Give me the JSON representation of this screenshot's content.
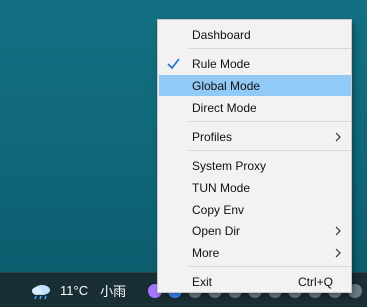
{
  "menu": {
    "items": [
      {
        "label": "Dashboard"
      },
      {
        "label": "Rule Mode",
        "checked": true
      },
      {
        "label": "Global Mode",
        "highlighted": true
      },
      {
        "label": "Direct Mode"
      },
      {
        "label": "Profiles",
        "submenu": true
      },
      {
        "label": "System Proxy"
      },
      {
        "label": "TUN Mode"
      },
      {
        "label": "Copy Env"
      },
      {
        "label": "Open Dir",
        "submenu": true
      },
      {
        "label": "More",
        "submenu": true
      },
      {
        "label": "Exit",
        "shortcut": "Ctrl+Q"
      }
    ],
    "highlight_color": "#91c9f7",
    "check_color": "#1e6fc8"
  },
  "taskbar": {
    "weather": {
      "icon": "cloud-rain-icon",
      "temperature": "11°C",
      "condition": "小雨"
    },
    "tray_icons": [
      "app-tray-icon-purple",
      "app-tray-icon-blue",
      "tray-icon",
      "tray-icon",
      "tray-icon",
      "tray-icon",
      "tray-icon",
      "tray-icon",
      "tray-icon",
      "tray-icon",
      "tray-icon",
      "tray-icon"
    ]
  }
}
